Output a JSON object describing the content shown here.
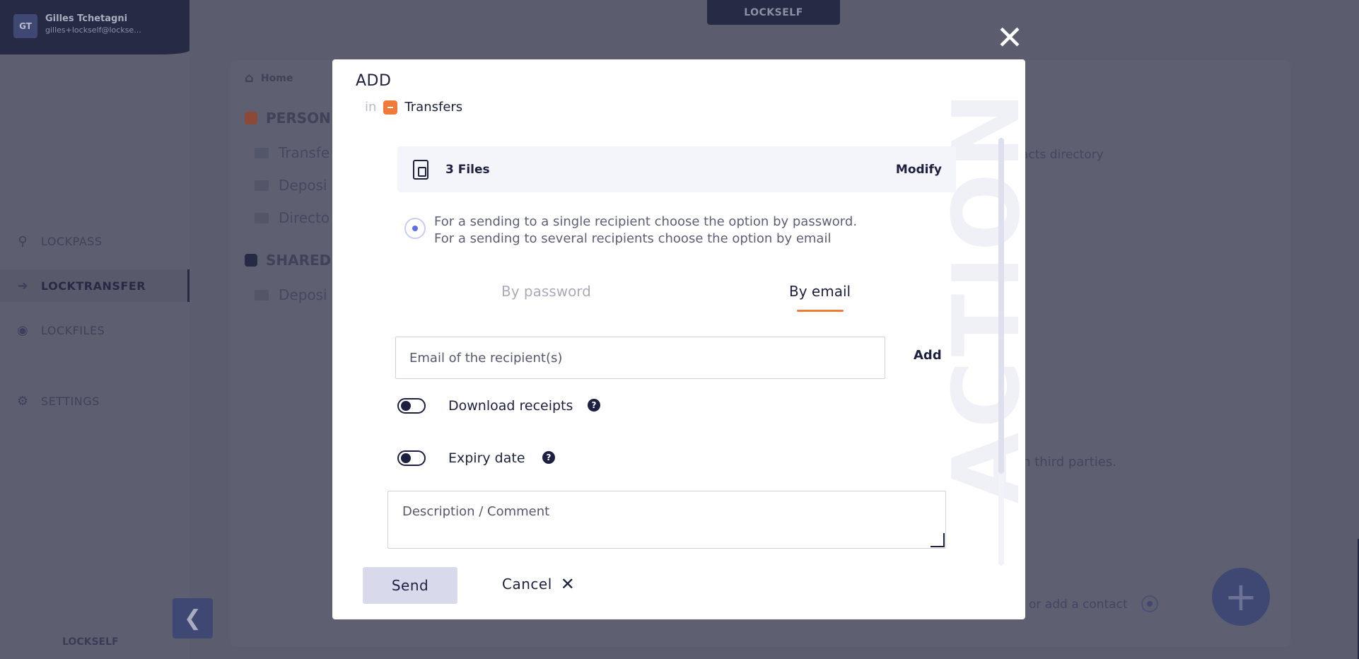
{
  "sidebar": {
    "user": {
      "initials": "GT",
      "name": "Gilles Tchetagni",
      "email": "gilles+lockself@lockse..."
    },
    "items": [
      {
        "label": "LOCKPASS",
        "icon": "key-icon"
      },
      {
        "label": "LOCKTRANSFER",
        "icon": "arrow-right-icon"
      },
      {
        "label": "LOCKFILES",
        "icon": "lock-icon"
      },
      {
        "label": "SETTINGS",
        "icon": "gears-icon"
      }
    ],
    "logo": "LOCKSELF"
  },
  "header": {
    "logo": "LOCKSELF"
  },
  "background": {
    "breadcrumb": "Home",
    "personal_heading": "PERSON",
    "personal_items": [
      "Transfe",
      "Deposi",
      "Directo"
    ],
    "shared_heading": "SHARED",
    "shared_items": [
      "Deposi"
    ],
    "contacts_text": "acts directory",
    "third_parties_text": "h third parties.",
    "add_contact_text": "or add a contact"
  },
  "modal": {
    "title": "ADD",
    "in_label": "in",
    "destination": "Transfers",
    "watermark": "ACTION",
    "files_label": "3 Files",
    "modify_label": "Modify",
    "info_line1": "For a sending to a single recipient choose the option by password.",
    "info_line2": "For a sending to several recipients choose the option by email",
    "tabs": {
      "password": "By password",
      "email": "By email",
      "active": "email"
    },
    "email_placeholder": "Email of the recipient(s)",
    "add_label": "Add",
    "download_receipts_label": "Download receipts",
    "expiry_date_label": "Expiry date",
    "comment_placeholder": "Description / Comment",
    "send_label": "Send",
    "cancel_label": "Cancel"
  },
  "colors": {
    "accent": "#f07a3a",
    "primary": "#1d2040",
    "overlay": "#5b5d6e"
  }
}
